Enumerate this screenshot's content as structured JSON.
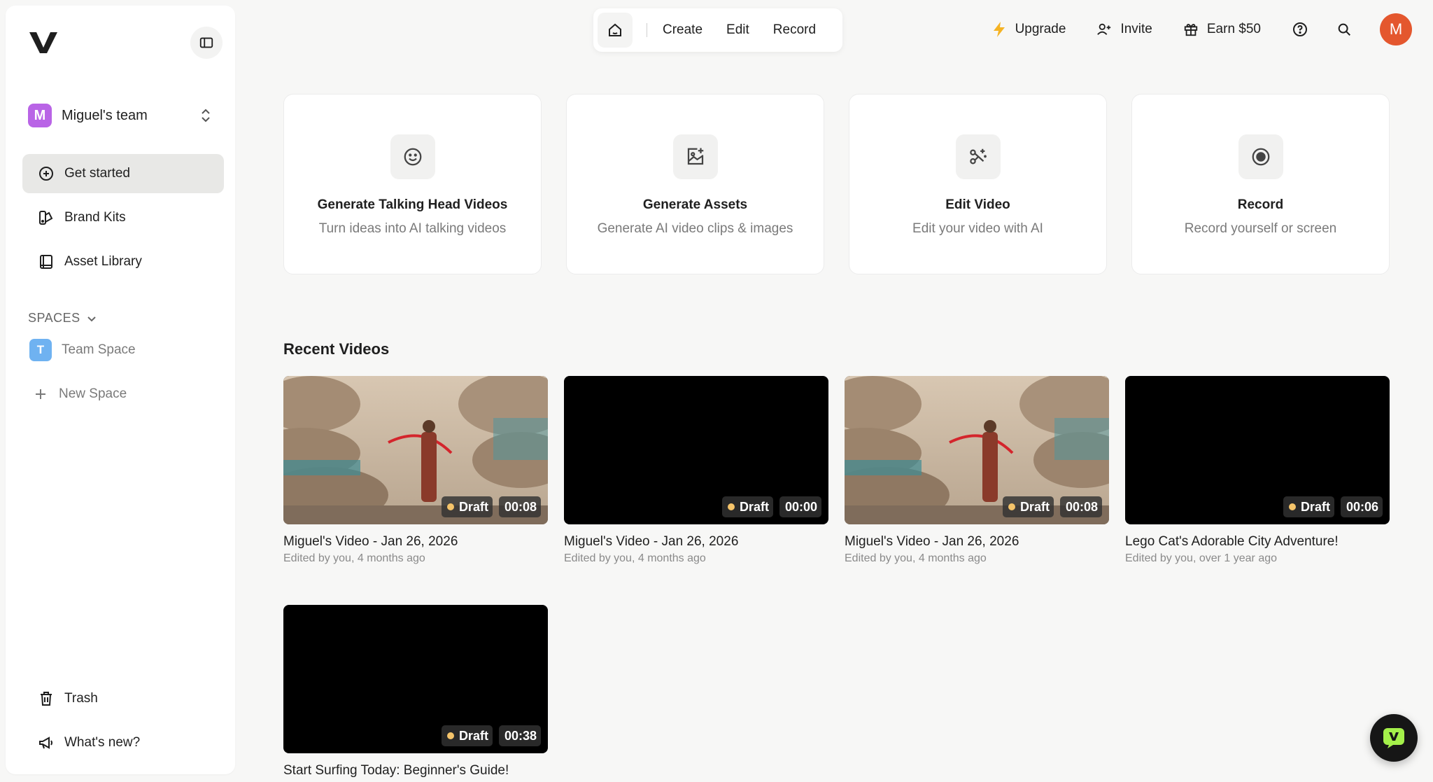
{
  "brand": {
    "logo_icon": "v-logo-icon"
  },
  "sidebar": {
    "team": {
      "initial": "M",
      "name": "Miguel's team"
    },
    "nav": [
      {
        "label": "Get started",
        "icon": "plus-circle-icon"
      },
      {
        "label": "Brand Kits",
        "icon": "brand-kit-icon"
      },
      {
        "label": "Asset Library",
        "icon": "book-icon"
      }
    ],
    "spaces_label": "SPACES",
    "spaces": [
      {
        "initial": "T",
        "label": "Team Space"
      }
    ],
    "new_space_label": "New Space",
    "bottom": [
      {
        "label": "Trash",
        "icon": "trash-icon"
      },
      {
        "label": "What's new?",
        "icon": "megaphone-icon"
      }
    ]
  },
  "topnav": {
    "links": [
      "Create",
      "Edit",
      "Record"
    ]
  },
  "top_actions": {
    "upgrade": "Upgrade",
    "invite": "Invite",
    "earn": "Earn $50",
    "user_initial": "M"
  },
  "cards": [
    {
      "title": "Generate Talking Head Videos",
      "subtitle": "Turn ideas into AI talking videos",
      "icon": "smile-icon"
    },
    {
      "title": "Generate Assets",
      "subtitle": "Generate AI video clips & images",
      "icon": "image-sparkle-icon"
    },
    {
      "title": "Edit Video",
      "subtitle": "Edit your video with AI",
      "icon": "scissors-sparkle-icon"
    },
    {
      "title": "Record",
      "subtitle": "Record yourself or screen",
      "icon": "record-icon"
    }
  ],
  "recent": {
    "title": "Recent Videos",
    "videos": [
      {
        "title": "Miguel's Video - Jan 26, 2026",
        "meta": "Edited by you, 4 months ago",
        "status": "Draft",
        "duration": "00:08",
        "thumbnail": "surreal-scene"
      },
      {
        "title": "Miguel's Video - Jan 26, 2026",
        "meta": "Edited by you, 4 months ago",
        "status": "Draft",
        "duration": "00:00",
        "thumbnail": "black"
      },
      {
        "title": "Miguel's Video - Jan 26, 2026",
        "meta": "Edited by you, 4 months ago",
        "status": "Draft",
        "duration": "00:08",
        "thumbnail": "surreal-scene"
      },
      {
        "title": "Lego Cat's Adorable City Adventure!",
        "meta": "Edited by you, over 1 year ago",
        "status": "Draft",
        "duration": "00:06",
        "thumbnail": "black"
      },
      {
        "title": "Start Surfing Today: Beginner's Guide!",
        "meta": "",
        "status": "Draft",
        "duration": "00:38",
        "thumbnail": "black"
      }
    ]
  },
  "colors": {
    "accent_orange": "#e4572e",
    "team_purple": "#b964e6",
    "space_blue": "#6fb2f1",
    "draft_dot": "#f5c46a",
    "chat_green": "#a4f04a"
  }
}
